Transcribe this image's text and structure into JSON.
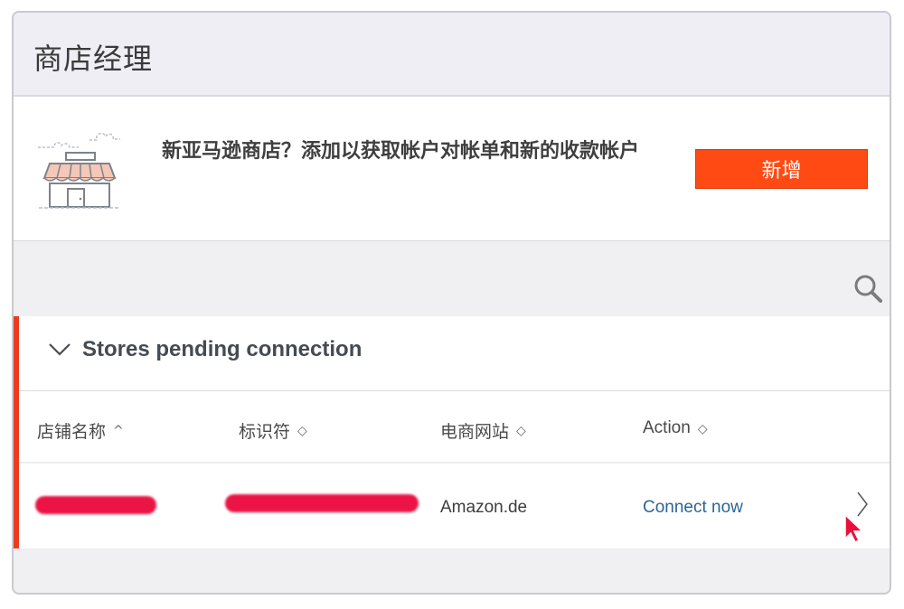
{
  "header": {
    "title": "商店经理"
  },
  "banner": {
    "illustration_icon": "storefront-icon",
    "message": "新亚马逊商店？添加以获取帐户对帐单和新的收款帐户",
    "add_button_label": "新增",
    "add_button_color": "#ff4a14"
  },
  "toolbar": {
    "search_icon": "search-icon"
  },
  "section": {
    "title": "Stores pending connection",
    "accent_color": "#ec3b1f",
    "collapse_icon": "chevron-down-icon"
  },
  "table": {
    "columns": [
      {
        "label": "店铺名称",
        "sort": "ascending"
      },
      {
        "label": "标识符",
        "sort": "unsorted"
      },
      {
        "label": "电商网站",
        "sort": "unsorted"
      },
      {
        "label": "Action",
        "sort": "unsorted"
      }
    ],
    "sort_icons": {
      "ascending": "^",
      "unsorted": "◇"
    },
    "rows": [
      {
        "store_name": "[redacted]",
        "identifier": "[redacted]",
        "marketplace": "Amazon.de",
        "action": "Connect now"
      }
    ],
    "link_color": "#2b6597"
  }
}
